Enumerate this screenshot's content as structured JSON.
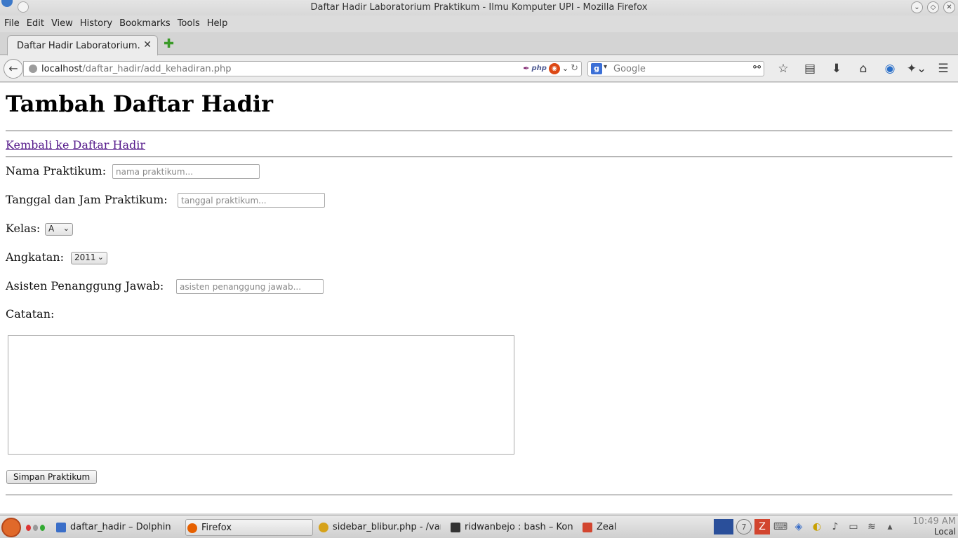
{
  "window": {
    "title": "Daftar Hadir Laboratorium Praktikum - Ilmu Komputer UPI - Mozilla Firefox"
  },
  "menu": [
    "File",
    "Edit",
    "View",
    "History",
    "Bookmarks",
    "Tools",
    "Help"
  ],
  "tab": {
    "label": "Daftar Hadir Laboratorium...",
    "close": "✕",
    "new_tab": "✚"
  },
  "address": {
    "host": "localhost",
    "path": "/daftar_hadir/add_kehadiran.php"
  },
  "search": {
    "engine_label": "g",
    "placeholder": "Google"
  },
  "toolbar_icons": [
    "star-icon",
    "reading-list-icon",
    "download-icon",
    "home-icon",
    "pocket-icon",
    "addon-icon",
    "menu-icon"
  ],
  "page": {
    "heading": "Tambah Daftar Hadir",
    "back_link": "Kembali ke Daftar Hadir",
    "fields": {
      "nama_label": "Nama Praktikum:",
      "nama_placeholder": "nama praktikum...",
      "tanggal_label": "Tanggal dan Jam Praktikum:",
      "tanggal_placeholder": "tanggal praktikum...",
      "kelas_label": "Kelas:",
      "kelas_value": "A",
      "angkatan_label": "Angkatan:",
      "angkatan_value": "2011",
      "asisten_label": "Asisten Penanggung Jawab:",
      "asisten_placeholder": "asisten penanggung jawab...",
      "catatan_label": "Catatan:"
    },
    "submit_label": "Simpan Praktikum"
  },
  "taskbar": {
    "items": [
      {
        "label": "daftar_hadir – Dolphin",
        "color": "#3a6ec8"
      },
      {
        "label": "Firefox",
        "color": "#e66000"
      },
      {
        "label": "sidebar_blibur.php - /var/",
        "color": "#d6a21a"
      },
      {
        "label": "ridwanbejo : bash – Konso",
        "color": "#333333"
      },
      {
        "label": "Zeal",
        "color": "#d2452f"
      }
    ],
    "tray_badge": "7",
    "clock_time": "10:49 AM",
    "clock_zone": "Local"
  }
}
